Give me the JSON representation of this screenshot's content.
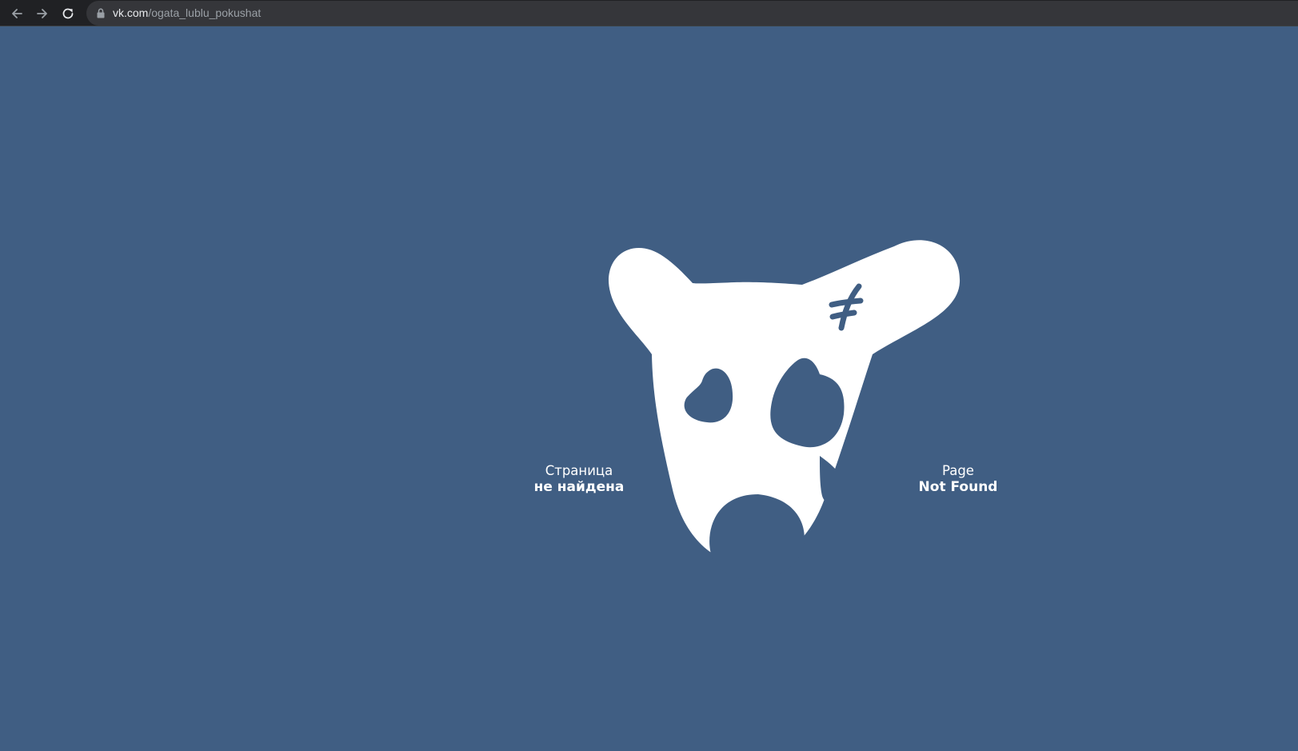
{
  "browser": {
    "url_host": "vk.com",
    "url_path": "/ogata_lublu_pokushat",
    "back_icon": "back-arrow-icon",
    "forward_icon": "forward-arrow-icon",
    "reload_icon": "reload-icon",
    "lock_icon": "lock-icon"
  },
  "error": {
    "ru_line1": "Страница",
    "ru_line2": "не найдена",
    "en_line1": "Page",
    "en_line2": "Not Found",
    "illustration": "sad-dog-illustration"
  },
  "colors": {
    "background": "#405e83",
    "foreground": "#ffffff",
    "chrome": "#202124"
  }
}
